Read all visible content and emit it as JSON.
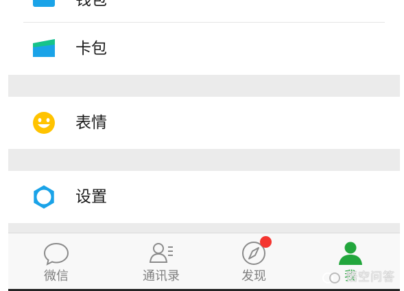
{
  "menu": {
    "wallet_label": "钱包",
    "cardpack_label": "卡包",
    "stickers_label": "表情",
    "settings_label": "设置"
  },
  "tabbar": {
    "chats_label": "微信",
    "contacts_label": "通讯录",
    "discover_label": "发现",
    "me_label": "我",
    "active_tab": "me"
  },
  "watermark": {
    "text": "悟空问答"
  },
  "colors": {
    "accent_green": "#22a63c",
    "icon_blue": "#1aa3e8",
    "emoji_yellow": "#ffc300",
    "badge_red": "#f43530",
    "section_gap": "#ebebeb"
  },
  "icons": {
    "wallet": "wallet-icon",
    "cardpack": "card-pack-icon",
    "stickers": "smiley-icon",
    "settings": "gear-icon",
    "chats": "chat-bubble-icon",
    "contacts": "contacts-icon",
    "discover": "compass-icon",
    "me": "person-icon"
  }
}
